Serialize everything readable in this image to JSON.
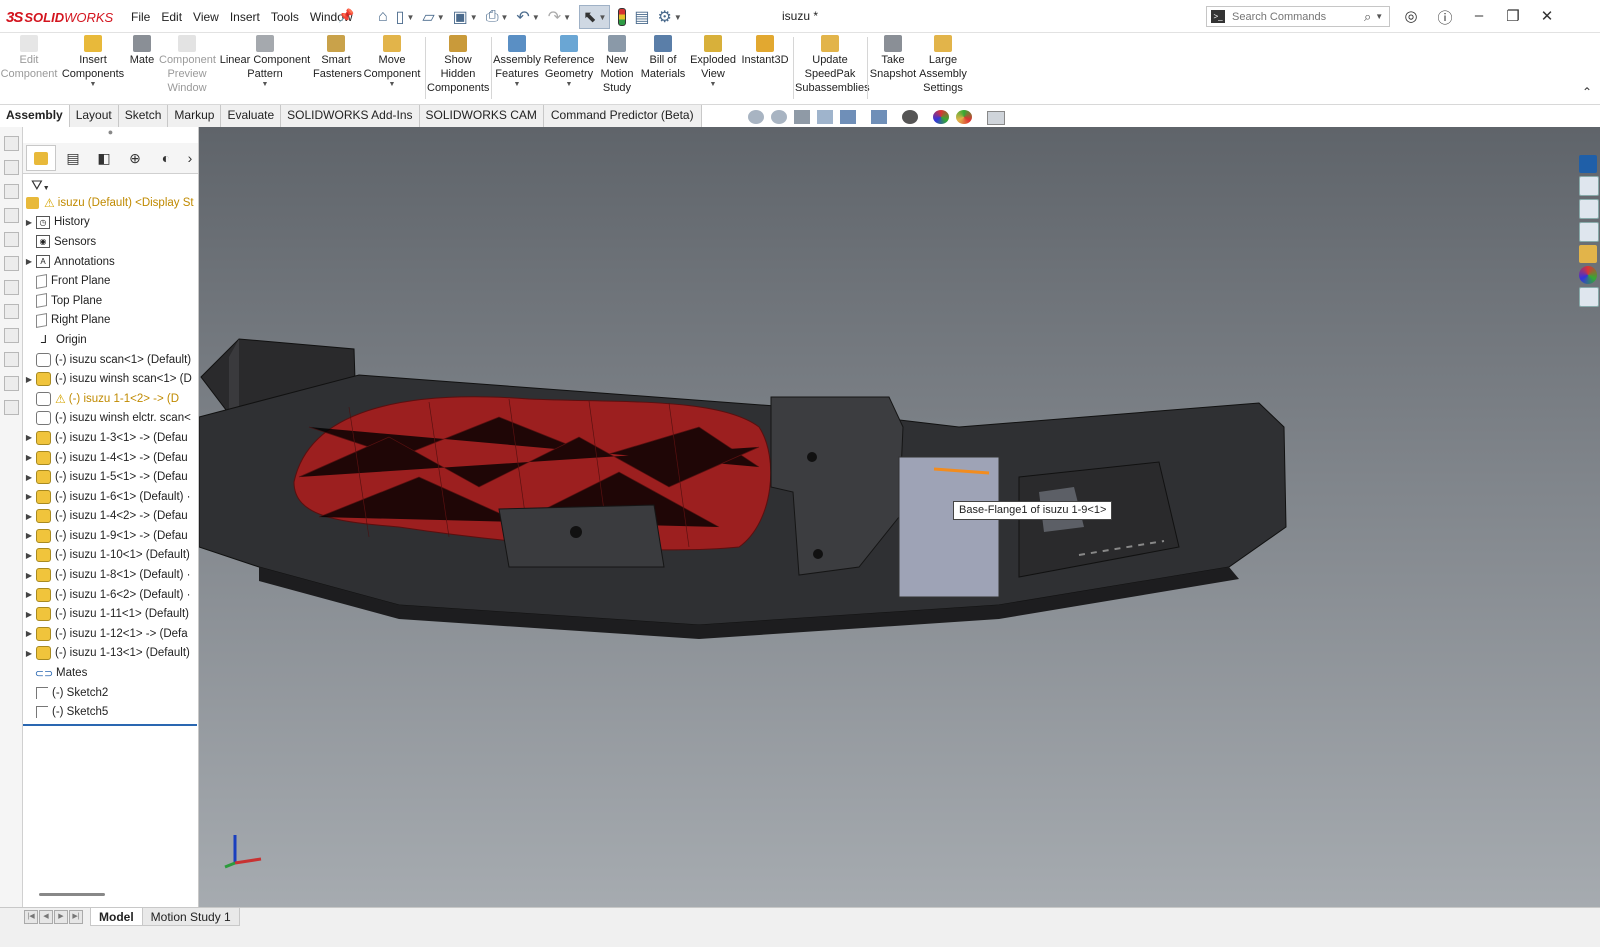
{
  "app": {
    "logo_ds": "3S",
    "logo_solid": "SOLID",
    "logo_works": "WORKS",
    "doc_title": "isuzu *"
  },
  "menus": [
    "File",
    "Edit",
    "View",
    "Insert",
    "Tools",
    "Window"
  ],
  "search": {
    "placeholder": "Search Commands"
  },
  "ribbon": {
    "edit_component": "Edit Component",
    "insert_components": "Insert Components",
    "mate": "Mate",
    "component_preview": "Component Preview Window",
    "linear_pattern": "Linear Component Pattern",
    "smart_fasteners": "Smart Fasteners",
    "move_component": "Move Component",
    "show_hidden": "Show Hidden Components",
    "assembly_features": "Assembly Features",
    "reference_geometry": "Reference Geometry",
    "motion_study": "New Motion Study",
    "bom": "Bill of Materials",
    "exploded_view": "Exploded View",
    "instant3d": "Instant3D",
    "speedpak": "Update SpeedPak Subassemblies",
    "snapshot": "Take Snapshot",
    "large_assembly": "Large Assembly Settings"
  },
  "tabs": [
    "Assembly",
    "Layout",
    "Sketch",
    "Markup",
    "Evaluate",
    "SOLIDWORKS Add-Ins",
    "SOLIDWORKS CAM",
    "Command Predictor (Beta)"
  ],
  "tree": {
    "root": "isuzu (Default) <Display St",
    "items": [
      "History",
      "Sensors",
      "Annotations",
      "Front Plane",
      "Top Plane",
      "Right Plane",
      "Origin",
      "(-) isuzu scan<1> (Default)",
      "(-) isuzu winsh scan<1> (D",
      "(-) isuzu 1-1<2> -> (D",
      "(-) isuzu winsh elctr. scan<",
      "(-) isuzu 1-3<1> -> (Defau",
      "(-) isuzu 1-4<1> -> (Defau",
      "(-) isuzu 1-5<1> -> (Defau",
      "(-) isuzu 1-6<1> (Default) ·",
      "(-) isuzu 1-4<2> -> (Defau",
      "(-) isuzu 1-9<1> -> (Defau",
      "(-) isuzu 1-10<1> (Default)",
      "(-) isuzu 1-8<1> (Default) ·",
      "(-) isuzu 1-6<2> (Default) ·",
      "(-) isuzu 1-11<1> (Default)",
      "(-) isuzu 1-12<1> -> (Defa",
      "(-) isuzu 1-13<1> (Default)",
      "Mates",
      "(-) Sketch2",
      "(-) Sketch5"
    ]
  },
  "viewport": {
    "tooltip": "Base-Flange1 of isuzu 1-9<1>"
  },
  "bottom_tabs": [
    "Model",
    "Motion Study 1"
  ],
  "colors": {
    "accent": "#2a67b1",
    "brand": "#d3141e",
    "mesh_red": "#b02020"
  }
}
